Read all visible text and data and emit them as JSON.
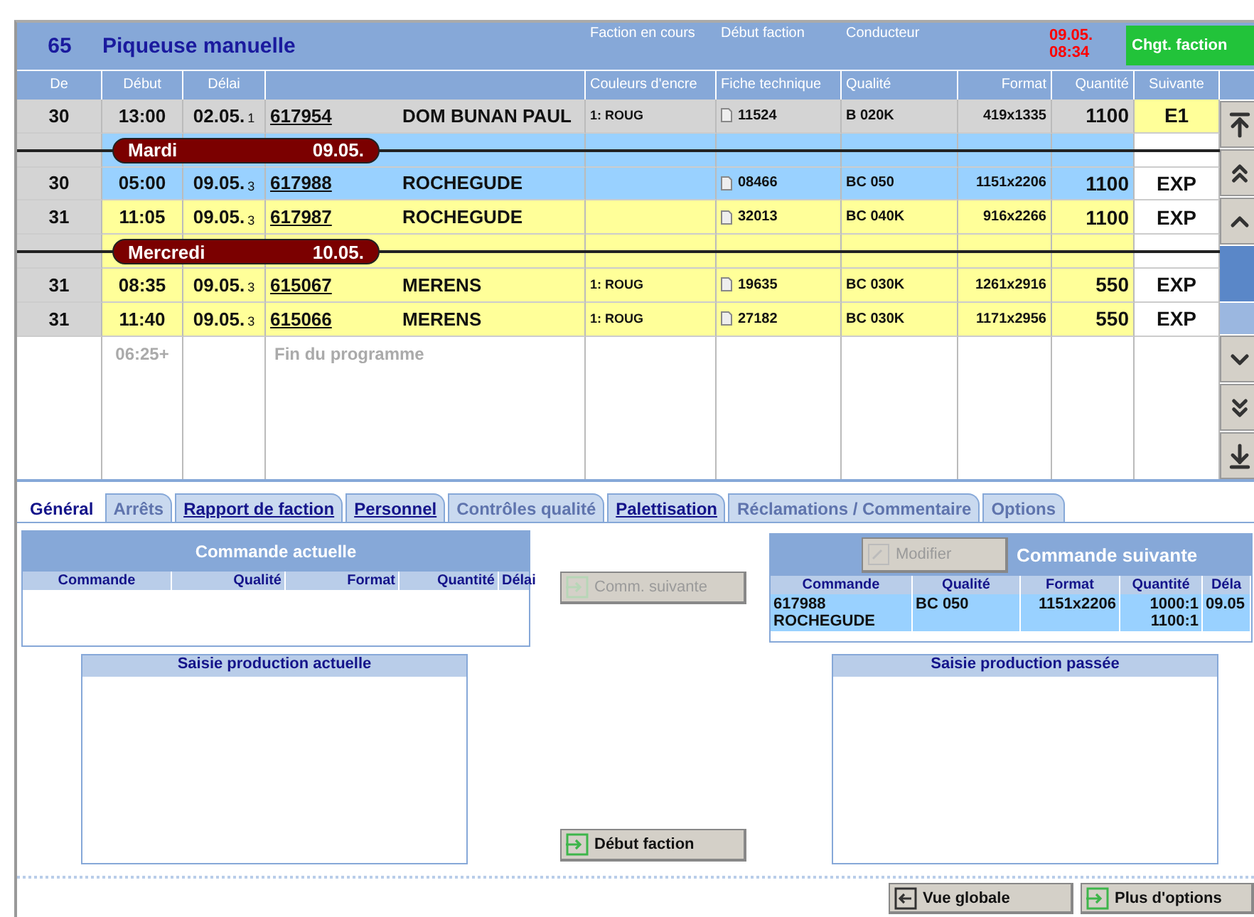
{
  "header": {
    "line_no": "65",
    "title": "Piqueuse manuelle",
    "labels": [
      "Faction en cours",
      "Début faction",
      "Conducteur"
    ],
    "clock": [
      "09.05.",
      "08:34"
    ],
    "action": "Chgt. faction"
  },
  "columns": [
    {
      "kind": "text",
      "label": "De"
    },
    {
      "kind": "text",
      "label": "Début"
    },
    {
      "kind": "text",
      "label": "Délai"
    },
    {
      "kind": "blank"
    },
    {
      "kind": "text",
      "label": "Couleurs d'encre"
    },
    {
      "kind": "text",
      "label": "Fiche technique"
    },
    {
      "kind": "text",
      "label": "Qualité"
    },
    {
      "kind": "text",
      "label": "Format"
    },
    {
      "kind": "text",
      "label": "Quantité"
    },
    {
      "kind": "text",
      "label": "Suivante"
    }
  ],
  "rows": [
    {
      "kind": "order",
      "color": "#d4d4d4",
      "shift": "30",
      "start": "13:00",
      "due": "02.05.",
      "due_index": "1",
      "order": "617954",
      "customer": "DOM BUNAN PAUL",
      "ink": "1: ROUG",
      "sheet": "11524",
      "quality": "B 020K",
      "format": "419x1335",
      "quantity": "1100",
      "next": "E1",
      "next_highlighted": true
    },
    {
      "kind": "day",
      "color": "#99d1ff",
      "day": "Mardi",
      "date": "09.05."
    },
    {
      "kind": "order",
      "color": "#99d1ff",
      "shift": "30",
      "start": "05:00",
      "due": "09.05.",
      "due_index": "3",
      "order": "617988",
      "customer": "ROCHEGUDE",
      "sheet": "08466",
      "quality": "BC 050",
      "format": "1151x2206",
      "quantity": "1100",
      "next": "EXP",
      "next_highlighted": false
    },
    {
      "kind": "order",
      "color": "#ffff99",
      "shift": "31",
      "start": "11:05",
      "due": "09.05.",
      "due_index": "3",
      "order": "617987",
      "customer": "ROCHEGUDE",
      "sheet": "32013",
      "quality": "BC 040K",
      "format": "916x2266",
      "quantity": "1100",
      "next": "EXP",
      "next_highlighted": false
    },
    {
      "kind": "day",
      "color": "#ffff99",
      "day": "Mercredi",
      "date": "10.05."
    },
    {
      "kind": "order",
      "color": "#ffff99",
      "shift": "31",
      "start": "08:35",
      "due": "09.05.",
      "due_index": "3",
      "order": "615067",
      "customer": "MERENS",
      "ink": "1: ROUG",
      "sheet": "19635",
      "quality": "BC 030K",
      "format": "1261x2916",
      "quantity": "550",
      "next": "EXP",
      "next_highlighted": false
    },
    {
      "kind": "order",
      "color": "#ffff99",
      "shift": "31",
      "start": "11:40",
      "due": "09.05.",
      "due_index": "3",
      "order": "615066",
      "customer": "MERENS",
      "ink": "1: ROUG",
      "sheet": "27182",
      "quality": "BC 030K",
      "format": "1171x2956",
      "quantity": "550",
      "next": "EXP",
      "next_highlighted": false
    },
    {
      "kind": "end",
      "start": "06:25+",
      "label": "Fin du programme"
    }
  ],
  "tabs": [
    {
      "label": "Général",
      "selected": true,
      "disabled": false
    },
    {
      "label": "Arrêts",
      "selected": false,
      "disabled": true
    },
    {
      "label": "Rapport de faction",
      "selected": false,
      "disabled": false
    },
    {
      "label": "Personnel",
      "selected": false,
      "disabled": false
    },
    {
      "label": "Contrôles qualité",
      "selected": false,
      "disabled": true
    },
    {
      "label": "Palettisation",
      "selected": false,
      "disabled": false
    },
    {
      "label": "Réclamations / Commentaire",
      "selected": false,
      "disabled": true
    },
    {
      "label": "Options",
      "selected": false,
      "disabled": true
    }
  ],
  "current_order": {
    "title": "Commande actuelle",
    "columns": [
      "Commande",
      "Qualité",
      "Format",
      "Quantité",
      "Délai"
    ]
  },
  "next_order_button": {
    "label": "Comm. suivante",
    "disabled": true
  },
  "next_order": {
    "title": "Commande suivante",
    "edit_button": {
      "label": "Modifier",
      "disabled": true
    },
    "columns": [
      "Commande",
      "Qualité",
      "Format",
      "Quantité",
      "Déla"
    ],
    "row": {
      "order": "617988",
      "customer": "ROCHEGUDE",
      "quality": "BC 050",
      "format": "1151x2206",
      "quantity": [
        "1000:1",
        "1100:1"
      ],
      "due": "09.05"
    }
  },
  "production_current": {
    "title": "Saisie production actuelle"
  },
  "production_past": {
    "title": "Saisie production passée"
  },
  "start_button": {
    "label": "Début faction",
    "disabled": false
  },
  "footer_buttons": [
    {
      "kind": "back",
      "label": "Vue globale"
    },
    {
      "kind": "enter",
      "label": "Plus d'options"
    }
  ]
}
